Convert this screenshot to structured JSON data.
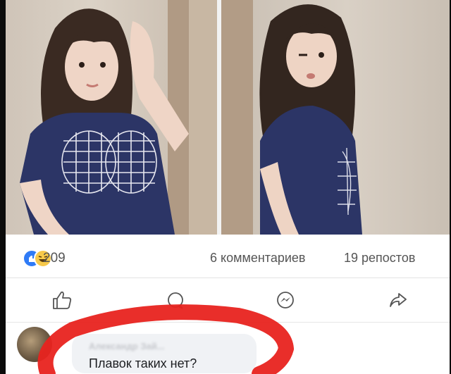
{
  "post": {
    "reactions": {
      "count": "209",
      "icons": [
        "like-reaction-icon",
        "haha-reaction-icon"
      ],
      "like_color": "#2f7bf6",
      "haha_color": "#f7c94a"
    },
    "comments_count": "6 комментариев",
    "reposts_count": "19 репостов",
    "actions": [
      "like-icon",
      "comment-icon",
      "messenger-icon",
      "share-icon"
    ]
  },
  "comment": {
    "author": "Александр Зай...",
    "text": "Плавок таких нет?",
    "highlight_color": "#e8231f"
  }
}
